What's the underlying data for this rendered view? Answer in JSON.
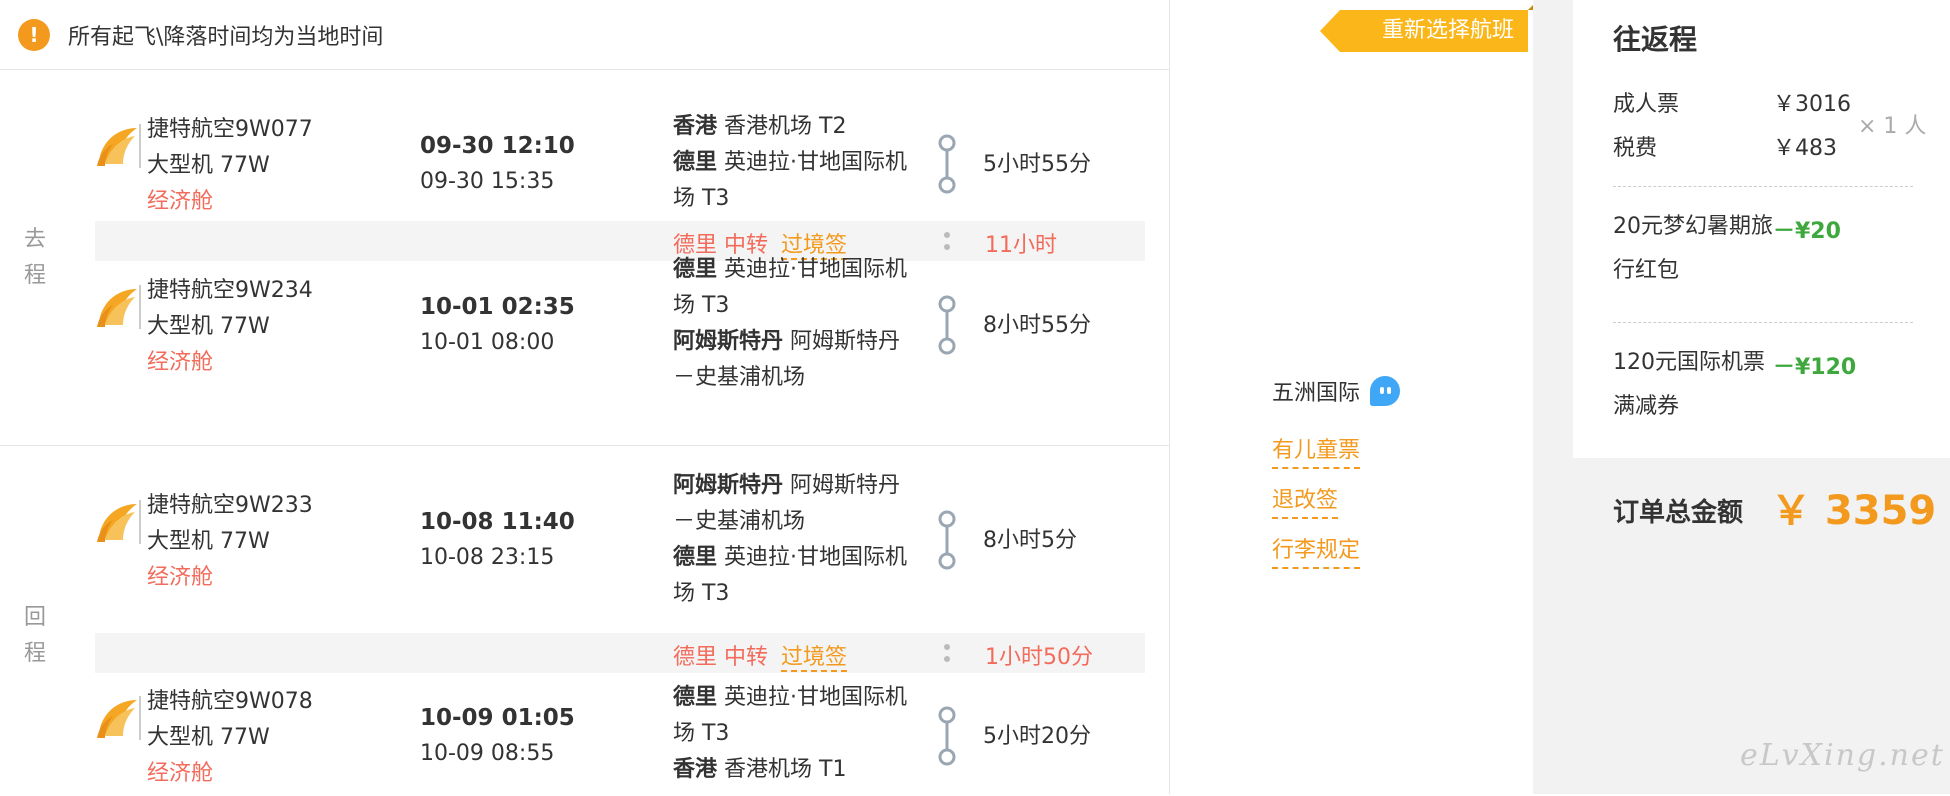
{
  "notice": {
    "icon": "!",
    "text": "所有起飞\\降落时间均为当地时间"
  },
  "outbound": {
    "label_chars": [
      "去",
      "程"
    ],
    "segments": [
      {
        "airline": "捷特航空9W077",
        "aircraft": "大型机 77W",
        "cabin": "经济舱",
        "dep_time": "09-30 12:10",
        "arr_time": "09-30 15:35",
        "from_city": "香港",
        "from_airport": "香港机场 T2",
        "to_city": "德里",
        "to_airport_1": "英迪拉·甘地国际机",
        "to_airport_2": "场 T3",
        "duration": "5小时55分"
      },
      {
        "airline": "捷特航空9W234",
        "aircraft": "大型机 77W",
        "cabin": "经济舱",
        "dep_time": "10-01 02:35",
        "arr_time": "10-01 08:00",
        "from_city": "德里",
        "from_airport_1": "英迪拉·甘地国际机",
        "from_airport_2": "场 T3",
        "to_city": "阿姆斯特丹",
        "to_airport_1": "阿姆斯特丹",
        "to_airport_2": "－史基浦机场",
        "duration": "8小时55分"
      }
    ],
    "transfer": {
      "city": "德里",
      "word": "中转",
      "visa": "过境签",
      "duration": "11小时"
    }
  },
  "return": {
    "label_chars": [
      "回",
      "程"
    ],
    "segments": [
      {
        "airline": "捷特航空9W233",
        "aircraft": "大型机 77W",
        "cabin": "经济舱",
        "dep_time": "10-08 11:40",
        "arr_time": "10-08 23:15",
        "from_city": "阿姆斯特丹",
        "from_airport_1": "阿姆斯特丹",
        "from_airport_2": "－史基浦机场",
        "to_city": "德里",
        "to_airport_1": "英迪拉·甘地国际机",
        "to_airport_2": "场 T3",
        "duration": "8小时5分"
      },
      {
        "airline": "捷特航空9W078",
        "aircraft": "大型机 77W",
        "cabin": "经济舱",
        "dep_time": "10-09 01:05",
        "arr_time": "10-09 08:55",
        "from_city": "德里",
        "from_airport_1": "英迪拉·甘地国际机",
        "from_airport_2": "场 T3",
        "to_city": "香港",
        "to_airport": "香港机场 T1",
        "duration": "5小时20分"
      }
    ],
    "transfer": {
      "city": "德里",
      "word": "中转",
      "visa": "过境签",
      "duration": "1小时50分"
    }
  },
  "middle": {
    "reselect_button": "重新选择航班",
    "agency": "五洲国际",
    "links": [
      "有儿童票",
      "退改签",
      "行李规定"
    ]
  },
  "summary": {
    "title": "往返程",
    "adult_label": "成人票",
    "adult_price": "￥3016",
    "tax_label": "税费",
    "tax_price": "￥483",
    "persons": "× 1 人",
    "promo1_name": "20元梦幻暑期旅行红包",
    "promo1_value": "－¥20",
    "promo2_name": "120元国际机票满减券",
    "promo2_value": "－¥120",
    "total_label": "订单总金额",
    "total_value": "￥ 3359"
  },
  "watermark": "eLvXing.net",
  "colors": {
    "accent_orange": "#f39a1e",
    "red_text": "#f26b5b",
    "green_discount": "#3ea83e",
    "button_yellow": "#fbb619",
    "chat_blue": "#3fa7f5"
  }
}
